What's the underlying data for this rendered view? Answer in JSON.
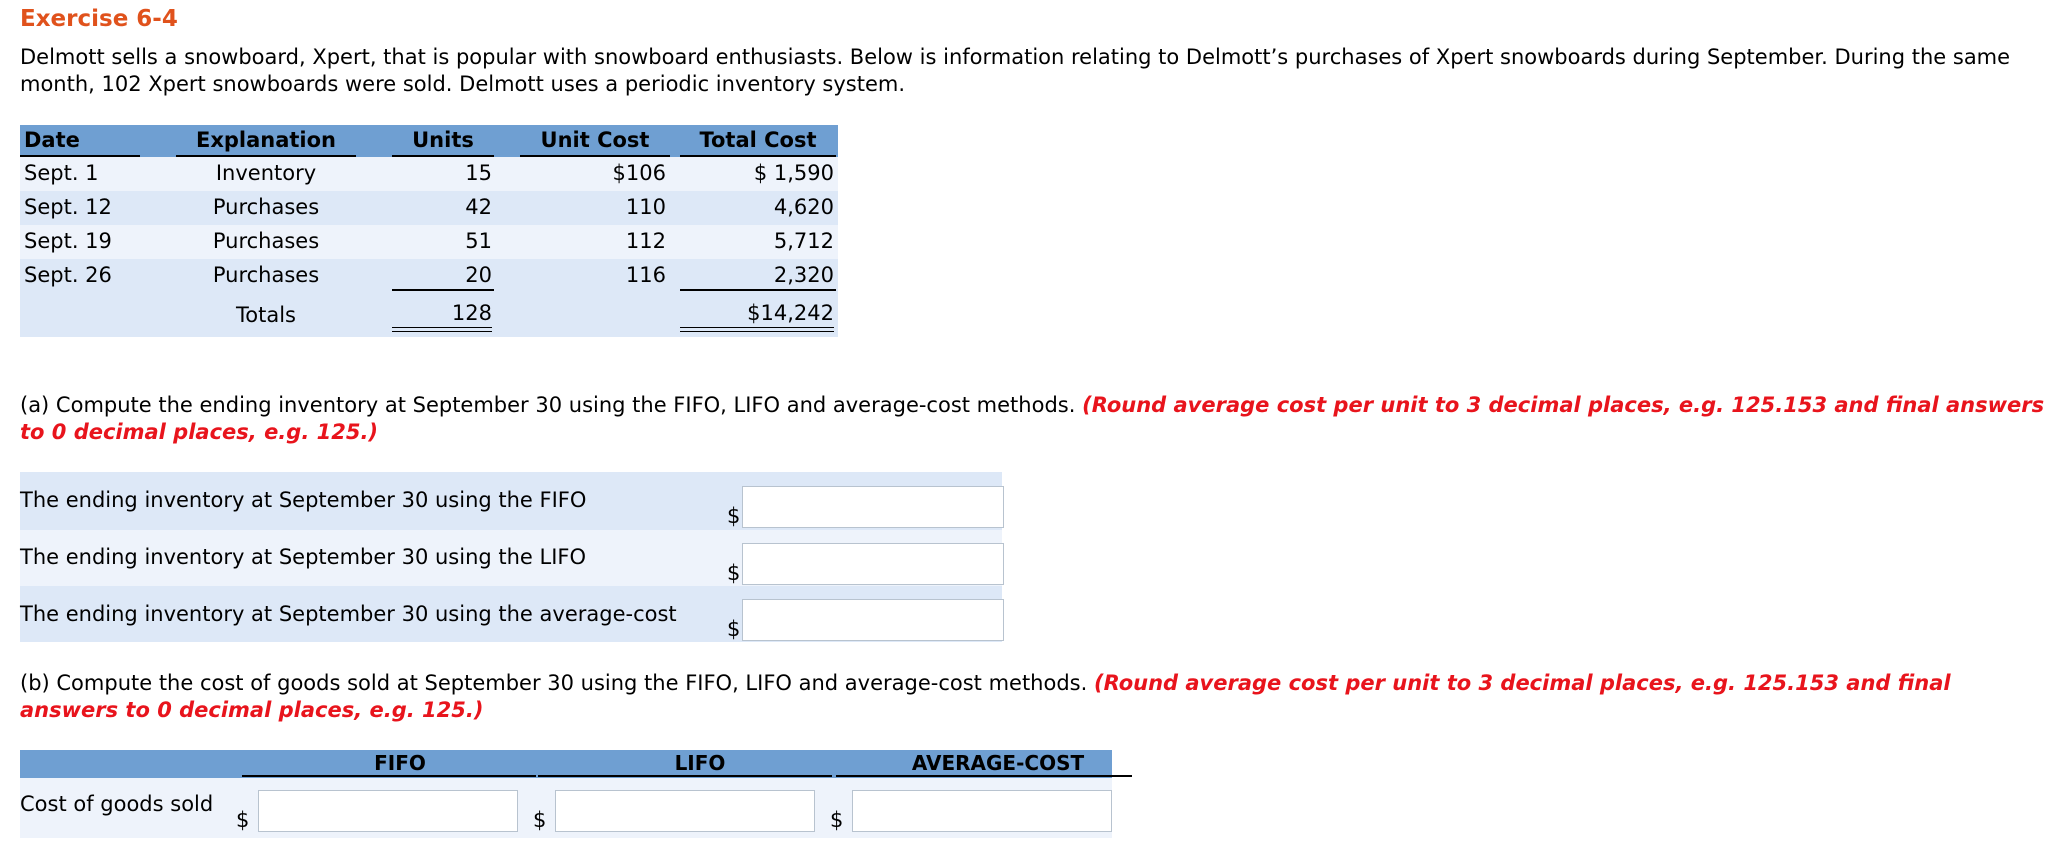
{
  "title": "Exercise 6-4",
  "intro": "Delmott sells a snowboard, Xpert, that is popular with snowboard enthusiasts. Below is information relating to Delmott’s purchases of Xpert snowboards during September. During the same month, 102 Xpert snowboards were sold. Delmott uses a periodic inventory system.",
  "purchases_table": {
    "headers": {
      "date": "Date",
      "explanation": "Explanation",
      "units": "Units",
      "unit_cost": "Unit Cost",
      "total_cost": "Total Cost"
    },
    "rows": [
      {
        "date": "Sept. 1",
        "explanation": "Inventory",
        "units": "15",
        "unit_cost": "$106",
        "total_cost": "$ 1,590"
      },
      {
        "date": "Sept. 12",
        "explanation": "Purchases",
        "units": "42",
        "unit_cost": "110",
        "total_cost": "4,620"
      },
      {
        "date": "Sept. 19",
        "explanation": "Purchases",
        "units": "51",
        "unit_cost": "112",
        "total_cost": "5,712"
      },
      {
        "date": "Sept. 26",
        "explanation": "Purchases",
        "units": "20",
        "unit_cost": "116",
        "total_cost": "2,320"
      }
    ],
    "totals": {
      "label": "Totals",
      "units": "128",
      "total_cost": "$14,242"
    }
  },
  "part_a": {
    "question": "(a) Compute the ending inventory at September 30 using the FIFO, LIFO and average-cost methods.",
    "note": "(Round average cost per unit to 3 decimal places, e.g. 125.153 and final answers to 0 decimal places, e.g. 125.)",
    "currency": "$",
    "rows": [
      {
        "label": "The ending inventory at September 30 using the FIFO",
        "value": ""
      },
      {
        "label": "The ending inventory at September 30 using the LIFO",
        "value": ""
      },
      {
        "label": "The ending inventory at September 30 using the average-cost",
        "value": ""
      }
    ]
  },
  "part_b": {
    "question": "(b) Compute the cost of goods sold at September 30 using the FIFO, LIFO and average-cost methods.",
    "note": "(Round average cost per unit to 3 decimal places, e.g. 125.153 and final answers to 0 decimal places, e.g. 125.)",
    "currency": "$",
    "headers": [
      "FIFO",
      "LIFO",
      "AVERAGE-COST"
    ],
    "row_label": "Cost of goods sold",
    "values": [
      "",
      "",
      ""
    ]
  },
  "colors": {
    "title": "#e0521c",
    "note_red": "#e8141c",
    "header_blue": "#6f9fd2",
    "row_light": "#eef3fb",
    "row_alt": "#dde8f7"
  }
}
